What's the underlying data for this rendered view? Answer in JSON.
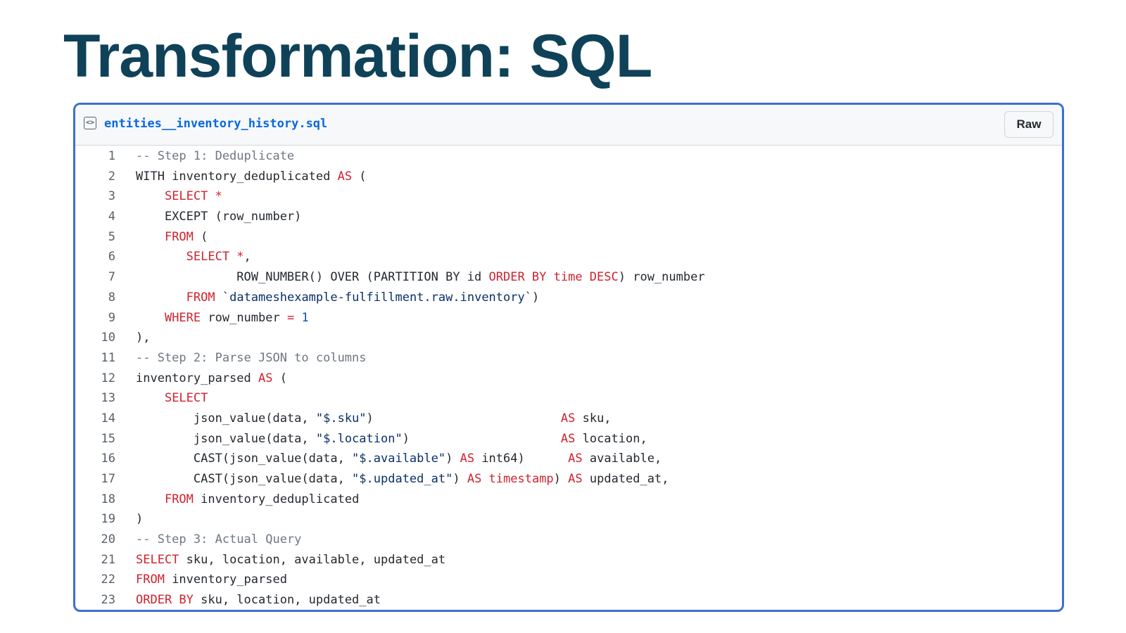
{
  "slide": {
    "title": "Transformation: SQL"
  },
  "file": {
    "name": "entities__inventory_history.sql",
    "icon": "code-file-icon",
    "raw_label": "Raw"
  },
  "colors": {
    "title": "#0f4258",
    "border": "#3b6fd3",
    "keyword": "#cf222e",
    "comment": "#6e7781",
    "string": "#0a3069",
    "number": "#0550ae"
  },
  "code_lines": [
    {
      "n": "1",
      "tokens": [
        [
          "c",
          "-- Step 1: Deduplicate"
        ]
      ]
    },
    {
      "n": "2",
      "tokens": [
        [
          "p",
          "WITH inventory_deduplicated "
        ],
        [
          "k",
          "AS"
        ],
        [
          "p",
          " ("
        ]
      ]
    },
    {
      "n": "3",
      "tokens": [
        [
          "p",
          "    "
        ],
        [
          "k",
          "SELECT *"
        ]
      ]
    },
    {
      "n": "4",
      "tokens": [
        [
          "p",
          "    EXCEPT (row_number)"
        ]
      ]
    },
    {
      "n": "5",
      "tokens": [
        [
          "p",
          "    "
        ],
        [
          "k",
          "FROM"
        ],
        [
          "p",
          " ("
        ]
      ]
    },
    {
      "n": "6",
      "tokens": [
        [
          "p",
          "       "
        ],
        [
          "k",
          "SELECT *"
        ],
        [
          "p",
          ","
        ]
      ]
    },
    {
      "n": "7",
      "tokens": [
        [
          "p",
          "              ROW_NUMBER() OVER (PARTITION BY id "
        ],
        [
          "k",
          "ORDER BY time DESC"
        ],
        [
          "p",
          ") row_number"
        ]
      ]
    },
    {
      "n": "8",
      "tokens": [
        [
          "p",
          "       "
        ],
        [
          "k",
          "FROM"
        ],
        [
          "p",
          " `"
        ],
        [
          "s",
          "datameshexample-fulfillment.raw.inventory"
        ],
        [
          "p",
          "`)"
        ]
      ]
    },
    {
      "n": "9",
      "tokens": [
        [
          "p",
          "    "
        ],
        [
          "k",
          "WHERE"
        ],
        [
          "p",
          " row_number "
        ],
        [
          "k",
          "="
        ],
        [
          "p",
          " "
        ],
        [
          "n",
          "1"
        ]
      ]
    },
    {
      "n": "10",
      "tokens": [
        [
          "p",
          "),"
        ]
      ]
    },
    {
      "n": "11",
      "tokens": [
        [
          "c",
          "-- Step 2: Parse JSON to columns"
        ]
      ]
    },
    {
      "n": "12",
      "tokens": [
        [
          "p",
          "inventory_parsed "
        ],
        [
          "k",
          "AS"
        ],
        [
          "p",
          " ("
        ]
      ]
    },
    {
      "n": "13",
      "tokens": [
        [
          "p",
          "    "
        ],
        [
          "k",
          "SELECT"
        ]
      ]
    },
    {
      "n": "14",
      "tokens": [
        [
          "p",
          "        json_value(data, "
        ],
        [
          "s",
          "\"$.sku\""
        ],
        [
          "p",
          ")                          "
        ],
        [
          "k",
          "AS"
        ],
        [
          "p",
          " sku,"
        ]
      ]
    },
    {
      "n": "15",
      "tokens": [
        [
          "p",
          "        json_value(data, "
        ],
        [
          "s",
          "\"$.location\""
        ],
        [
          "p",
          ")                     "
        ],
        [
          "k",
          "AS"
        ],
        [
          "p",
          " location,"
        ]
      ]
    },
    {
      "n": "16",
      "tokens": [
        [
          "p",
          "        CAST(json_value(data, "
        ],
        [
          "s",
          "\"$.available\""
        ],
        [
          "p",
          ") "
        ],
        [
          "k",
          "AS"
        ],
        [
          "p",
          " int64)      "
        ],
        [
          "k",
          "AS"
        ],
        [
          "p",
          " available,"
        ]
      ]
    },
    {
      "n": "17",
      "tokens": [
        [
          "p",
          "        CAST(json_value(data, "
        ],
        [
          "s",
          "\"$.updated_at\""
        ],
        [
          "p",
          ") "
        ],
        [
          "k",
          "AS timestamp"
        ],
        [
          "p",
          ") "
        ],
        [
          "k",
          "AS"
        ],
        [
          "p",
          " updated_at,"
        ]
      ]
    },
    {
      "n": "18",
      "tokens": [
        [
          "p",
          "    "
        ],
        [
          "k",
          "FROM"
        ],
        [
          "p",
          " inventory_deduplicated"
        ]
      ]
    },
    {
      "n": "19",
      "tokens": [
        [
          "p",
          ")"
        ]
      ]
    },
    {
      "n": "20",
      "tokens": [
        [
          "c",
          "-- Step 3: Actual Query"
        ]
      ]
    },
    {
      "n": "21",
      "tokens": [
        [
          "k",
          "SELECT"
        ],
        [
          "p",
          " sku, location, available, updated_at"
        ]
      ]
    },
    {
      "n": "22",
      "tokens": [
        [
          "k",
          "FROM"
        ],
        [
          "p",
          " inventory_parsed"
        ]
      ]
    },
    {
      "n": "23",
      "tokens": [
        [
          "k",
          "ORDER BY"
        ],
        [
          "p",
          " sku, location, updated_at"
        ]
      ]
    }
  ]
}
